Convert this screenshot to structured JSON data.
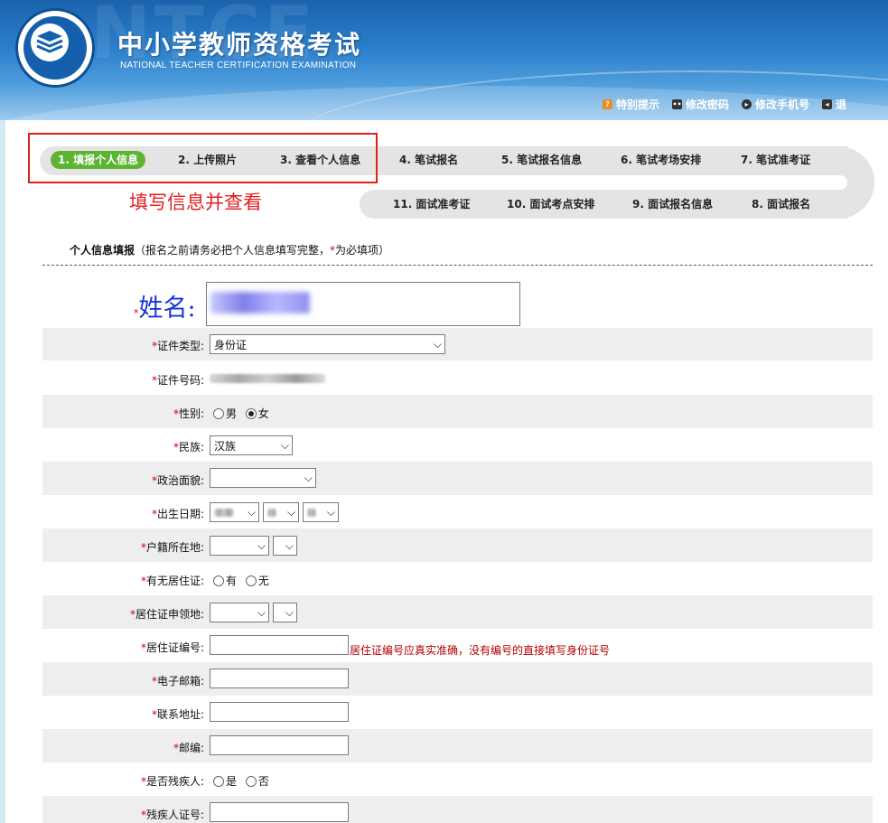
{
  "header": {
    "title_cn": "中小学教师资格考试",
    "title_en": "NATIONAL TEACHER CERTIFICATION EXAMINATION",
    "watermark": "NTCE",
    "logo_ring_text": "National Teacher Certification Examination",
    "nav": [
      {
        "label": "特别提示",
        "icon": "warning-icon",
        "color": "#f08a24"
      },
      {
        "label": "修改密码",
        "icon": "key-icon",
        "color": "#333333"
      },
      {
        "label": "修改手机号",
        "icon": "phone-icon",
        "color": "#333333"
      },
      {
        "label": "退",
        "icon": "logout-icon",
        "color": "#333333"
      }
    ]
  },
  "steps": {
    "top": [
      {
        "label": "1. 填报个人信息",
        "active": true
      },
      {
        "label": "2. 上传照片",
        "active": false
      },
      {
        "label": "3. 查看个人信息",
        "active": false
      },
      {
        "label": "4. 笔试报名",
        "active": false
      },
      {
        "label": "5. 笔试报名信息",
        "active": false
      },
      {
        "label": "6. 笔试考场安排",
        "active": false
      },
      {
        "label": "7. 笔试准考证",
        "active": false
      }
    ],
    "bottom": [
      {
        "label": "11. 面试准考证"
      },
      {
        "label": "10. 面试考点安排"
      },
      {
        "label": "9. 面试报名信息"
      },
      {
        "label": "8. 面试报名"
      }
    ],
    "annotation": "填写信息并查看",
    "active_color": "#5cb531"
  },
  "form": {
    "title": "个人信息填报",
    "subtitle_pre": "（报名之前请务必把个人信息填写完整，",
    "required_mark": "*",
    "subtitle_post": "为必填项）",
    "name_label": "姓名:",
    "fields": {
      "id_type": {
        "label": "证件类型:",
        "value": "身份证"
      },
      "id_number": {
        "label": "证件号码:"
      },
      "gender": {
        "label": "性别:",
        "options": [
          "男",
          "女"
        ],
        "selected": "女"
      },
      "ethnicity": {
        "label": "民族:",
        "value": "汉族"
      },
      "political": {
        "label": "政治面貌:",
        "value": ""
      },
      "birth": {
        "label": "出生日期:"
      },
      "hukou": {
        "label": "户籍所在地:"
      },
      "residence_permit": {
        "label": "有无居住证:",
        "options": [
          "有",
          "无"
        ],
        "selected": ""
      },
      "permit_place": {
        "label": "居住证申领地:"
      },
      "permit_number": {
        "label": "居住证编号:",
        "value": "",
        "hint": "居住证编号应真实准确，没有编号的直接填写身份证号"
      },
      "email": {
        "label": "电子邮箱:",
        "value": ""
      },
      "address": {
        "label": "联系地址:",
        "value": ""
      },
      "postcode": {
        "label": "邮编:",
        "value": ""
      },
      "disabled": {
        "label": "是否残疾人:",
        "options": [
          "是",
          "否"
        ],
        "selected": ""
      },
      "disability_cert": {
        "label": "残疾人证号:",
        "value": ""
      }
    }
  }
}
